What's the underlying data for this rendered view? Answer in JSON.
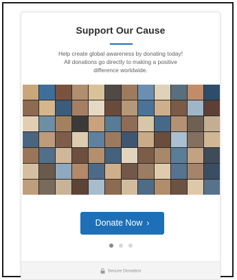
{
  "card": {
    "title": "Support Our Cause",
    "description_lines": [
      "Help create global awareness by donating today!",
      "All donations go directly to making a positive",
      "difference worldwide."
    ],
    "accent_color": "#1d6fb8"
  },
  "collage": {
    "alt": "Photo collage of supporters",
    "tile_colors": [
      "#c9a77a",
      "#3f6e9b",
      "#7a5240",
      "#b08f6e",
      "#d9c29a",
      "#4f4a45",
      "#9d7b5c",
      "#6b8fb1",
      "#e0d2b8",
      "#5a6f7d",
      "#c28c68",
      "#2e4d6b",
      "#8d6a51",
      "#d4b58c",
      "#3b5c7a",
      "#a57f63",
      "#e5d9c4",
      "#6a4b3b",
      "#b69778",
      "#4b7398",
      "#cdb08b",
      "#7b5a46",
      "#9fb6c9",
      "#5c4035",
      "#e2cfb2",
      "#6e8ea6",
      "#a3815f",
      "#3c3a38",
      "#c7a27c",
      "#587b96",
      "#8f6c55",
      "#d8c6a9",
      "#476887",
      "#b59173",
      "#706052",
      "#c4ae92",
      "#4a6580",
      "#bd9b7b",
      "#7e5e4a",
      "#deccaf",
      "#5f819e",
      "#9c7a60",
      "#3e5670",
      "#c9ab88",
      "#6b4d3d",
      "#a9c0d0",
      "#857060",
      "#d1b694",
      "#9a7557",
      "#526f8a",
      "#cfb797",
      "#6d4f40",
      "#b2906f",
      "#44617e",
      "#e3d5bd",
      "#7c5d49",
      "#a88868",
      "#5b7d99",
      "#c3a282",
      "#3f4b57",
      "#d6bfa0",
      "#6a5a4c",
      "#8fa9be",
      "#b3896a",
      "#4d6b88",
      "#cfae8a",
      "#73584a",
      "#9b7d64",
      "#e0ccad",
      "#56738f",
      "#a5846a",
      "#3a4e63",
      "#bf9e7e",
      "#7a6a5c",
      "#c8b396",
      "#5e4436",
      "#a7bccc",
      "#8c6b52",
      "#d3bc9d",
      "#4f6c87",
      "#b08d6c",
      "#6c5243",
      "#ddc8a8",
      "#58728c"
    ]
  },
  "donate_button": {
    "label": "Donate Now",
    "chevron": "›"
  },
  "pagination": {
    "count": 3,
    "active_index": 0
  },
  "footer": {
    "secure_text": "Secure Donation",
    "icon": "lock-icon"
  }
}
